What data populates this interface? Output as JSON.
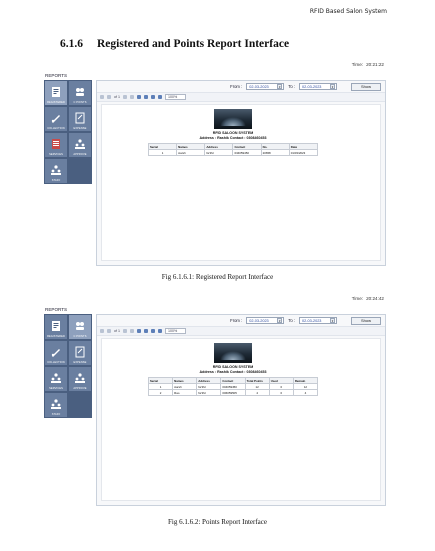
{
  "running_header": "RFID Based Salon System",
  "section": {
    "number": "6.1.6",
    "title": "Registered and Points Report Interface"
  },
  "sidebar_label": "REPORTS",
  "menu_items": [
    {
      "label": "REGISTERED",
      "icon": "document-icon"
    },
    {
      "label": "C POINTS",
      "icon": "users-icon"
    },
    {
      "label": "COLLECTION",
      "icon": "pen-icon"
    },
    {
      "label": "EXPENSE",
      "icon": "notepad-icon"
    },
    {
      "label": "SERVICES",
      "icon": "clipboard-icon"
    },
    {
      "label": "APPROVE",
      "icon": "group-icon"
    },
    {
      "label": "STAFF",
      "icon": "group-icon"
    }
  ],
  "filter": {
    "from_label": "From :",
    "to_label": "To :",
    "show_label": "Show"
  },
  "report": {
    "title": "RFID SALOON SYSTEM",
    "address": "Address : Rashik Contact : 0308460453"
  },
  "screens": [
    {
      "time_label": "Time:",
      "time_value": "20:21:22",
      "from_date": "02-03-2023",
      "to_date": "02-03-2023",
      "pager": "of 1",
      "zoom": "100%",
      "columns": [
        "Serial",
        "Names",
        "Address",
        "Contact",
        "No.",
        "Date"
      ],
      "rows": [
        [
          "1",
          "Aarsh",
          "fsr3fd",
          "034059450",
          "20658",
          "01/03/2023"
        ]
      ],
      "caption": "Fig 6.1.6.1: Registered Report Interface"
    },
    {
      "time_label": "Time:",
      "time_value": "20:24:42",
      "from_date": "02-03-2023",
      "to_date": "02-03-2023",
      "pager": "of 1",
      "zoom": "100%",
      "columns": [
        "Serial",
        "Names",
        "Address",
        "Contact",
        "Total Points",
        "Used",
        "Remain"
      ],
      "rows": [
        [
          "1",
          "Aarsh",
          "fsr3fd",
          "004059450",
          "12",
          "0",
          "12"
        ],
        [
          "2",
          "Rao",
          "fsr3fd",
          "006059505",
          "4",
          "0",
          "4"
        ]
      ],
      "caption": "Fig 6.1.6.2: Points Report Interface"
    }
  ]
}
